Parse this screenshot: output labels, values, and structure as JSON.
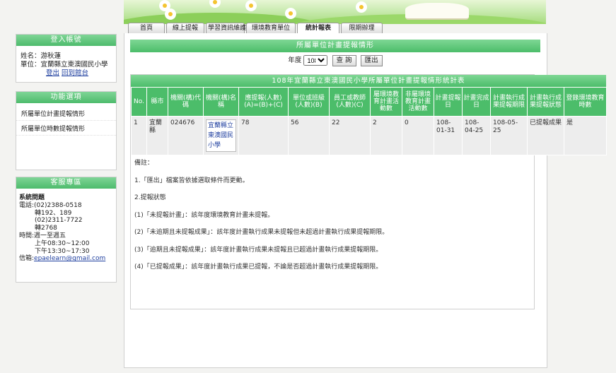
{
  "tabs": [
    {
      "label": "首頁"
    },
    {
      "label": "線上提報"
    },
    {
      "label": "學習資訊維護"
    },
    {
      "label": "環境教育單位"
    },
    {
      "label": "統計報表"
    },
    {
      "label": "限期辦理"
    }
  ],
  "login": {
    "title": "登入帳號",
    "name_label": "姓名：",
    "name": "游秋蓮",
    "unit_label": "單位：",
    "unit": "宜蘭縣立東澳國民小學",
    "logout": "登出",
    "back": "回到館台"
  },
  "func": {
    "title": "功能選項",
    "items": [
      "所屬單位計畫提報情形",
      "所屬單位時數提報情形"
    ]
  },
  "service": {
    "title": "客服專區",
    "heading": "系統問題",
    "phone_label": "電話:",
    "phone1": "(02)2388-0518",
    "ext1": "轉192、189",
    "phone2": "(02)2311-7722",
    "ext2": "轉2768",
    "time_label": "時間:",
    "days": "週一至週五",
    "am": "上午08:30~12:00",
    "pm": "下午13:30~17:30",
    "mail_label": "信箱:",
    "email": "epaelearn@gmail.com"
  },
  "main": {
    "title": "所屬單位計畫提報情形",
    "year_label": "年度",
    "year": "108",
    "query": "查 詢",
    "export": "匯出",
    "table_title": "108年宜蘭縣立東澳國民小學所屬單位計畫提報情形統計表",
    "headers": [
      "No.",
      "縣市",
      "機關(構)代碼",
      "機關(構)名稱",
      "應提報(人數)(A)=(B)+(C)",
      "單位或班級(人數)(B)",
      "員工或教師(人數)(C)",
      "屬環境教育計畫活動數",
      "非屬環境教育計畫活動數",
      "計畫提報日",
      "計畫完成日",
      "計畫執行成果提報期限",
      "計畫執行成果提報狀態",
      "登錄環境教育時數"
    ],
    "row": {
      "no": "1",
      "county": "宜蘭縣",
      "code": "024676",
      "name": "宜蘭縣立東澳國民小學",
      "should": "78",
      "unit": "56",
      "staff": "22",
      "env_act": "2",
      "non_env_act": "0",
      "submit_date": "108-01-31",
      "finish_date": "108-04-25",
      "deadline": "108-05-25",
      "status": "已提報成果",
      "hours": "是"
    },
    "notes": [
      "備註：",
      "1.「匯出」檔案皆依據選取條件而更動。",
      "2.提報狀態",
      "(1)「未提報計畫」：該年度環境教育計畫未提報。",
      "(2)「未逾期且未提報成果」：該年度計畫執行成果未提報但未超過計畫執行成果提報期限。",
      "(3)「逾期且未提報成果」：該年度計畫執行成果未提報且已超過計畫執行成果提報期限。",
      "(4)「已提報成果」：該年度計畫執行成果已提報，不論是否超過計畫執行成果提報期限。"
    ]
  }
}
